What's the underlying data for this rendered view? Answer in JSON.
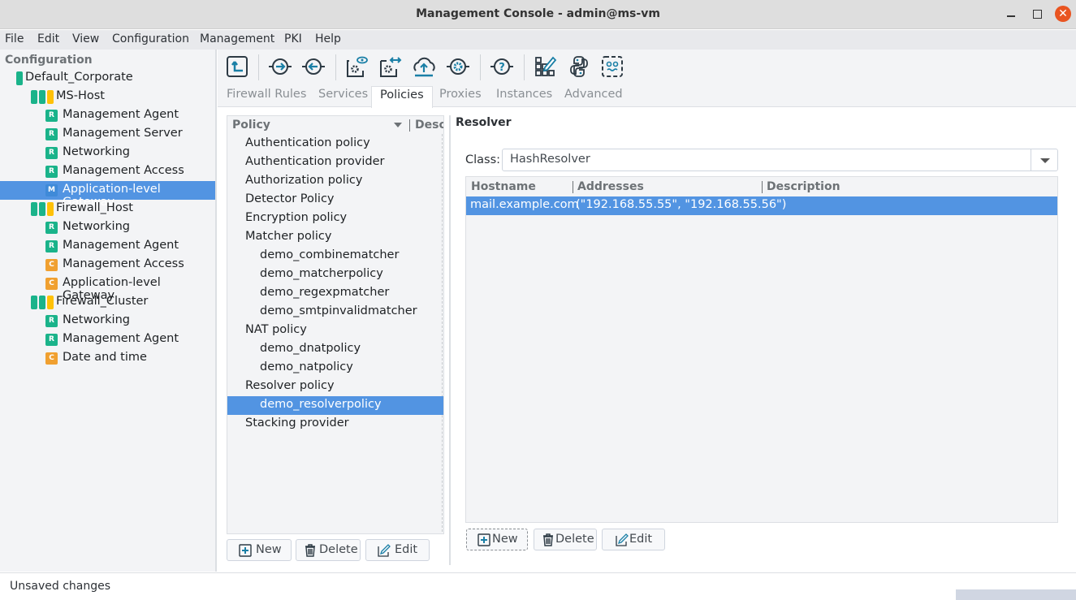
{
  "window": {
    "title": "Management Console - admin@ms-vm",
    "controls": {
      "minimize": "minimize",
      "maximize": "maximize",
      "close": "✕"
    }
  },
  "menubar": [
    "File",
    "Edit",
    "View",
    "Configuration",
    "Management",
    "PKI",
    "Help"
  ],
  "sidebar": {
    "title": "Configuration",
    "tree": [
      {
        "label": "Default_Corporate",
        "type": "site",
        "level": 0
      },
      {
        "label": "MS-Host",
        "type": "host",
        "level": 1
      },
      {
        "label": "Management Agent",
        "badge": "R",
        "level": 2
      },
      {
        "label": "Management Server",
        "badge": "R",
        "level": 2
      },
      {
        "label": "Networking",
        "badge": "R",
        "level": 2
      },
      {
        "label": "Management Access",
        "badge": "R",
        "level": 2
      },
      {
        "label": "Application-level Gateway",
        "badge": "M",
        "level": 2,
        "selected": true
      },
      {
        "label": "Firewall_Host",
        "type": "host",
        "level": 1
      },
      {
        "label": "Networking",
        "badge": "R",
        "level": 2
      },
      {
        "label": "Management Agent",
        "badge": "R",
        "level": 2
      },
      {
        "label": "Management Access",
        "badge": "C",
        "level": 2
      },
      {
        "label": "Application-level Gateway",
        "badge": "C",
        "level": 2
      },
      {
        "label": "Firewall_Cluster",
        "type": "host",
        "level": 1
      },
      {
        "label": "Networking",
        "badge": "R",
        "level": 2
      },
      {
        "label": "Management Agent",
        "badge": "R",
        "level": 2
      },
      {
        "label": "Date and time",
        "badge": "C",
        "level": 2
      }
    ]
  },
  "toolbar": {
    "icons": [
      "upload-config-icon",
      "connect-in-icon",
      "connect-out-icon",
      "view-config-icon",
      "compare-config-icon",
      "cloud-upload-icon",
      "service-control-icon",
      "help-icon",
      "edit-grid-icon",
      "python-icon",
      "console-icon"
    ]
  },
  "tabs": [
    {
      "label": "Firewall Rules",
      "active": false
    },
    {
      "label": "Services",
      "active": false
    },
    {
      "label": "Policies",
      "active": true
    },
    {
      "label": "Proxies",
      "active": false
    },
    {
      "label": "Instances",
      "active": false
    },
    {
      "label": "Advanced",
      "active": false
    }
  ],
  "policy_panel": {
    "columns": [
      "Policy",
      "Description"
    ],
    "items": [
      {
        "label": "Authentication policy",
        "level": 0
      },
      {
        "label": "Authentication provider",
        "level": 0
      },
      {
        "label": "Authorization policy",
        "level": 0
      },
      {
        "label": "Detector Policy",
        "level": 0
      },
      {
        "label": "Encryption policy",
        "level": 0
      },
      {
        "label": "Matcher policy",
        "level": 0
      },
      {
        "label": "demo_combinematcher",
        "level": 1
      },
      {
        "label": "demo_matcherpolicy",
        "level": 1
      },
      {
        "label": "demo_regexpmatcher",
        "level": 1
      },
      {
        "label": "demo_smtpinvalidmatcher",
        "level": 1
      },
      {
        "label": "NAT policy",
        "level": 0
      },
      {
        "label": "demo_dnatpolicy",
        "level": 1
      },
      {
        "label": "demo_natpolicy",
        "level": 1
      },
      {
        "label": "Resolver policy",
        "level": 0
      },
      {
        "label": "demo_resolverpolicy",
        "level": 1,
        "selected": true
      },
      {
        "label": "Stacking provider",
        "level": 0
      }
    ],
    "buttons": {
      "new": "New",
      "delete": "Delete",
      "edit": "Edit"
    }
  },
  "resolver": {
    "title": "Resolver",
    "class_label": "Class:",
    "class_value": "HashResolver",
    "columns": [
      "Hostname",
      "Addresses",
      "Description"
    ],
    "rows": [
      {
        "hostname": "mail.example.com",
        "addresses": "(\"192.168.55.55\", \"192.168.55.56\")",
        "description": "",
        "selected": true
      }
    ],
    "buttons": {
      "new": "New",
      "delete": "Delete",
      "edit": "Edit"
    }
  },
  "statusbar": {
    "text": "Unsaved changes"
  },
  "colors": {
    "selection": "#5294e2",
    "badge_R": "#1ab38a",
    "badge_C": "#f0a030",
    "badge_M": "#3f8ad8",
    "host_bar_green": "#1ab38a",
    "host_bar_yellow": "#ffc107",
    "close_button": "#e95420",
    "icon_accent": "#1a7fa6"
  }
}
